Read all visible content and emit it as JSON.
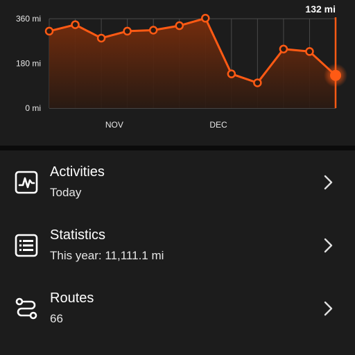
{
  "chart_data": {
    "type": "line",
    "y_ticks": [
      "360 mi",
      "180 mi",
      "0 mi"
    ],
    "ylim": [
      0,
      360
    ],
    "unit": "mi",
    "x_labels": [
      {
        "label": "NOV",
        "index": 3
      },
      {
        "label": "DEC",
        "index": 7
      }
    ],
    "values": [
      310,
      336,
      282,
      310,
      314,
      332,
      362,
      138,
      102,
      238,
      228,
      132
    ],
    "current_value_label": "132 mi",
    "line_color": "#ff5a14",
    "fill_color_top": "#7a2e0c"
  },
  "menu": {
    "items": [
      {
        "title": "Activities",
        "subtitle": "Today",
        "icon": "activity-chart-icon"
      },
      {
        "title": "Statistics",
        "subtitle": "This year: 11,111.1 mi",
        "icon": "list-icon"
      },
      {
        "title": "Routes",
        "subtitle": "66",
        "icon": "route-icon"
      }
    ]
  }
}
